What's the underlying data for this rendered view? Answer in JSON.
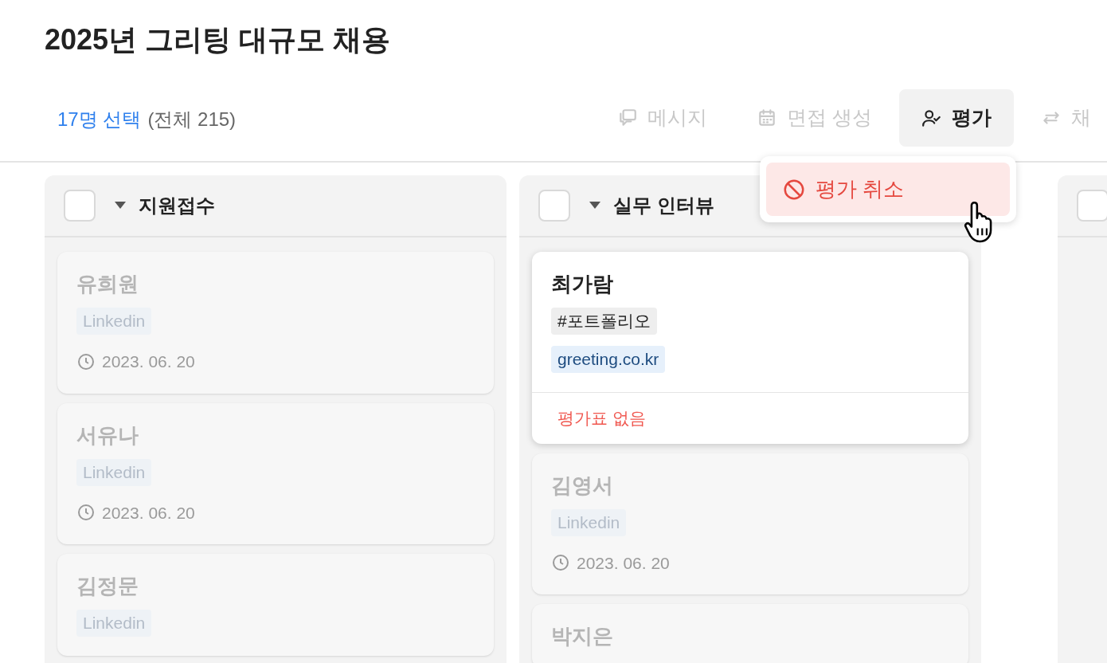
{
  "title": "2025년 그리팅 대규모 채용",
  "selection": {
    "selected_label": "17명 선택",
    "total_label": "(전체 215)"
  },
  "toolbar": [
    {
      "kind": "message",
      "label": "메시지",
      "disabled": true,
      "selected": false
    },
    {
      "kind": "calendar",
      "label": "면접 생성",
      "disabled": true,
      "selected": false
    },
    {
      "kind": "evaluate",
      "label": "평가",
      "disabled": false,
      "selected": true
    },
    {
      "kind": "move",
      "label": "채",
      "disabled": true,
      "selected": false
    }
  ],
  "menu": {
    "items": [
      {
        "label": "평가 취소",
        "highlighted": true
      }
    ]
  },
  "columns": [
    {
      "title": "지원접수",
      "checked": false,
      "cards": [
        {
          "name": "유희원",
          "dimmed": true,
          "tags": [
            {
              "kind": "source",
              "label": "Linkedin"
            }
          ],
          "date": "2023. 06. 20"
        },
        {
          "name": "서유나",
          "dimmed": true,
          "tags": [
            {
              "kind": "source",
              "label": "Linkedin"
            }
          ],
          "date": "2023. 06. 20"
        },
        {
          "name": "김정문",
          "dimmed": true,
          "tags": [
            {
              "kind": "source",
              "label": "Linkedin"
            }
          ]
        }
      ]
    },
    {
      "title": "실무 인터뷰",
      "checked": false,
      "cards": [
        {
          "name": "최가람",
          "dimmed": false,
          "tags": [
            {
              "kind": "hashtag",
              "label": "#포트폴리오"
            },
            {
              "kind": "link",
              "label": "greeting.co.kr"
            }
          ],
          "footer": "평가표 없음"
        },
        {
          "name": "김영서",
          "dimmed": true,
          "tags": [
            {
              "kind": "source",
              "label": "Linkedin"
            }
          ],
          "date": "2023. 06. 20"
        },
        {
          "name": "박지은",
          "dimmed": true
        }
      ]
    },
    {
      "checked": false
    }
  ]
}
